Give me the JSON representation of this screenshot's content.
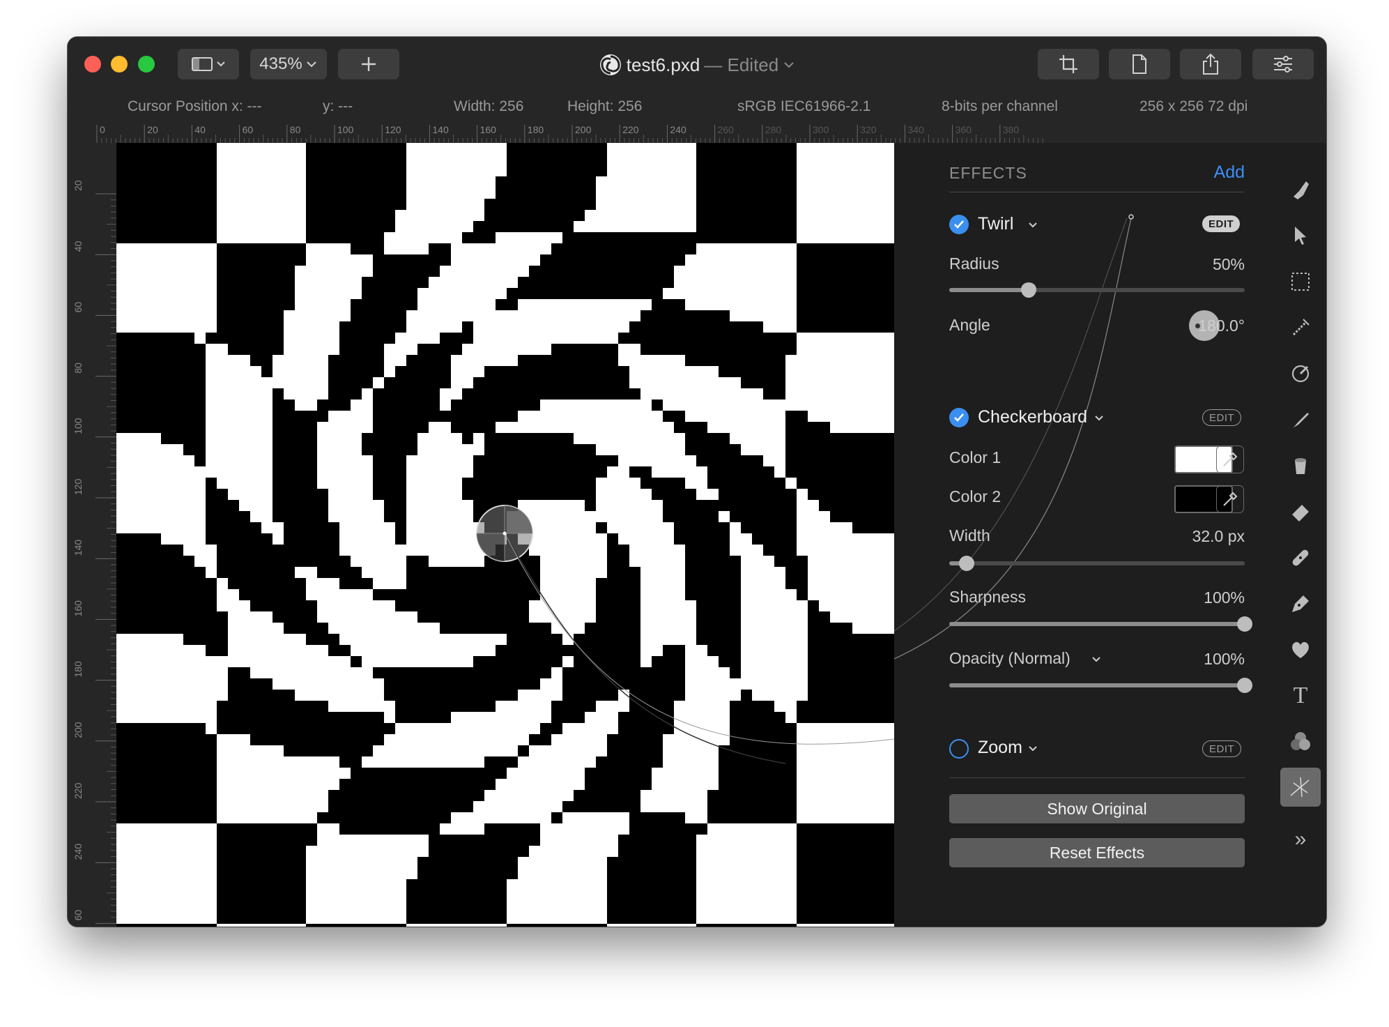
{
  "window": {
    "zoom": "435%",
    "document_name": "test6.pxd",
    "edited_label": "— Edited"
  },
  "infobar": {
    "cursor_x": "Cursor Position x: ---",
    "cursor_y": "y: ---",
    "width": "Width: 256",
    "height": "Height: 256",
    "color_profile": "sRGB IEC61966-2.1",
    "bit_depth": "8-bits per channel",
    "resolution": "256  x 256 72 dpi"
  },
  "rulers": {
    "top": [
      "0",
      "20",
      "40",
      "60",
      "80",
      "100",
      "120",
      "140",
      "160",
      "180",
      "200",
      "220",
      "240",
      "260",
      "280",
      "300",
      "320",
      "340",
      "360",
      "380"
    ],
    "left": [
      "20",
      "40",
      "60",
      "80",
      "100",
      "120",
      "140",
      "160",
      "180",
      "200",
      "220",
      "240",
      "60"
    ]
  },
  "effects": {
    "header": "EFFECTS",
    "add_label": "Add",
    "twirl": {
      "name": "Twirl",
      "edit_label": "EDIT",
      "enabled": true,
      "radius_label": "Radius",
      "radius_value": "50%",
      "radius_fraction": 0.27,
      "angle_label": "Angle",
      "angle_value": "180.0°"
    },
    "checkerboard": {
      "name": "Checkerboard",
      "edit_label": "EDIT",
      "enabled": true,
      "color1_label": "Color 1",
      "color1": "#ffffff",
      "color2_label": "Color 2",
      "color2": "#000000",
      "width_label": "Width",
      "width_value": "32.0 px",
      "width_fraction": 0.06,
      "sharpness_label": "Sharpness",
      "sharpness_value": "100%",
      "sharpness_fraction": 1.0,
      "opacity_label": "Opacity (Normal)",
      "opacity_value": "100%",
      "opacity_fraction": 1.0
    },
    "zoom": {
      "name": "Zoom",
      "edit_label": "EDIT",
      "enabled": false
    }
  },
  "buttons": {
    "show_original": "Show Original",
    "reset_effects": "Reset Effects"
  },
  "tools": {
    "text_tool_glyph": "T",
    "more_glyph": "»"
  },
  "colors": {
    "accent": "#3b8ff0",
    "link": "#3d8ef7"
  }
}
